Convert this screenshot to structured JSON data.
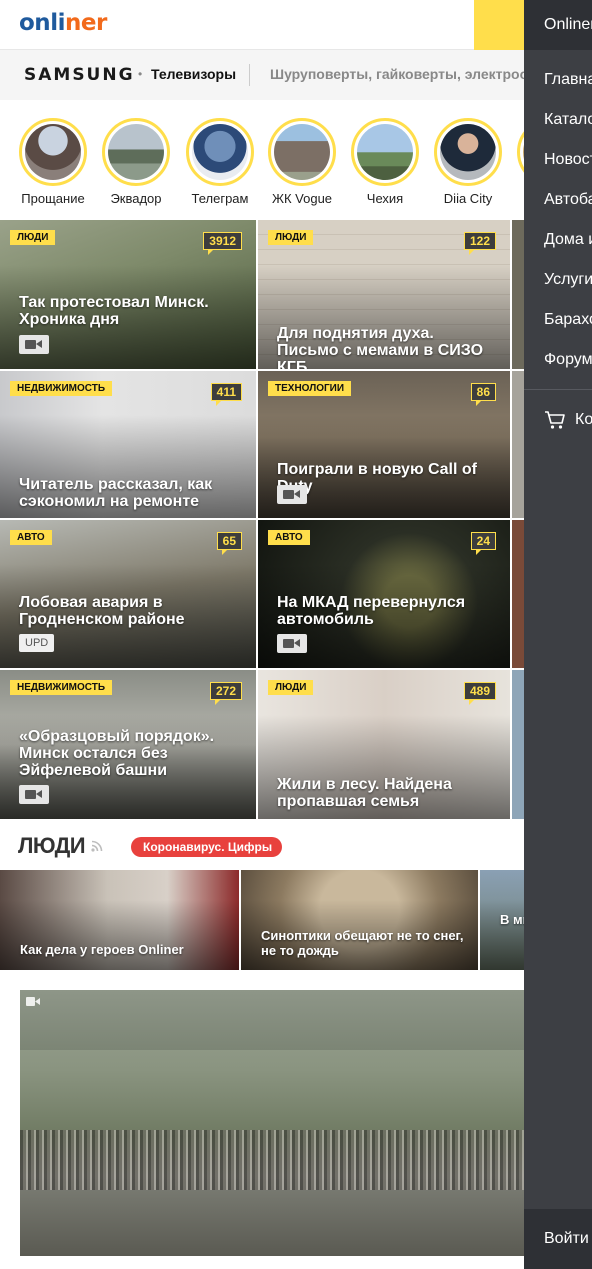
{
  "header": {
    "logo_part1": "on",
    "logo_part2": "li",
    "logo_part3": "ner"
  },
  "promo": {
    "brand": "SAMSUNG",
    "dot": "•",
    "category": "Телевизоры",
    "more": "Шуруповерты, гайковерты, электроот"
  },
  "stories": [
    {
      "label": "Прощание"
    },
    {
      "label": "Эквадор"
    },
    {
      "label": "Телеграм"
    },
    {
      "label": "ЖК Vogue"
    },
    {
      "label": "Чехия"
    },
    {
      "label": "Diia City"
    }
  ],
  "tiles": [
    {
      "tag": "Люди",
      "count": "3912",
      "title": "Так протестовал Минск. Хроника дня",
      "badge": "video"
    },
    {
      "tag": "Люди",
      "count": "122",
      "title": "Для поднятия духа. Письмо с мемами в СИЗО КГБ",
      "badge": ""
    },
    {
      "tag": "Недвижимость",
      "count": "411",
      "title": "Читатель рассказал, как сэкономил на ремонте",
      "badge": ""
    },
    {
      "tag": "Технологии",
      "count": "86",
      "title": "Поиграли в новую Call of Duty",
      "badge": "video"
    },
    {
      "tag": "Авто",
      "count": "65",
      "title": "Лобовая авария в Гродненском районе",
      "badge": "UPD"
    },
    {
      "tag": "Авто",
      "count": "24",
      "title": "На МКАД перевернулся автомобиль",
      "badge": "video"
    },
    {
      "tag": "Недвижимость",
      "count": "272",
      "title": "«Образцовый порядок». Минск остался без Эйфелевой башни",
      "badge": "video"
    },
    {
      "tag": "Люди",
      "count": "489",
      "title": "Жили в лесу. Найдена пропавшая семья",
      "badge": ""
    }
  ],
  "section": {
    "title": "ЛЮДИ",
    "pill": "Коронавирус. Цифры"
  },
  "strip": [
    {
      "title": "Как дела у героев Onliner"
    },
    {
      "title": "Синоптики обещают не то снег, не то дождь"
    },
    {
      "title": "В ми отра госп"
    }
  ],
  "side_menu": {
    "brand": "Onliner",
    "items": [
      "Главная",
      "Каталог",
      "Новости",
      "Автобарахолка",
      "Дома и квартиры",
      "Услуги",
      "Барахолка",
      "Форум"
    ],
    "cart": "Корзина",
    "login": "Войти"
  },
  "colors": {
    "accent_yellow": "#ffde4b",
    "brand_blue": "#1f5a9d",
    "sidebar_bg": "#3d3f44",
    "red_pill": "#e8413d"
  }
}
